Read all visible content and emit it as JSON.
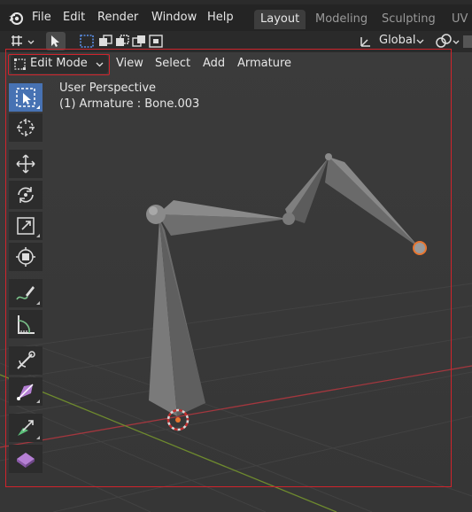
{
  "menu": {
    "file": "File",
    "edit": "Edit",
    "render": "Render",
    "window": "Window",
    "help": "Help"
  },
  "workspaces": [
    "Layout",
    "Modeling",
    "Sculpting",
    "UV E"
  ],
  "header": {
    "orientation": "Global",
    "mode": "Edit Mode",
    "view": "View",
    "select": "Select",
    "add": "Add",
    "armature": "Armature"
  },
  "viewport": {
    "perspective": "User Perspective",
    "object_info": "(1) Armature : Bone.003"
  },
  "toolbar_icons": [
    "select-box-icon",
    "cursor-icon",
    "move-icon",
    "rotate-icon",
    "scale-icon",
    "transform-icon",
    "annotate-icon",
    "measure-icon",
    "roll-icon",
    "bone-size-icon",
    "extrude-icon",
    "bone-envelope-icon"
  ],
  "colors": {
    "accent": "#4772b3",
    "selected_joint": "#e8752f",
    "frame": "#d0242c",
    "axis_x": "#a3373e",
    "axis_y": "#6e8a2e"
  }
}
